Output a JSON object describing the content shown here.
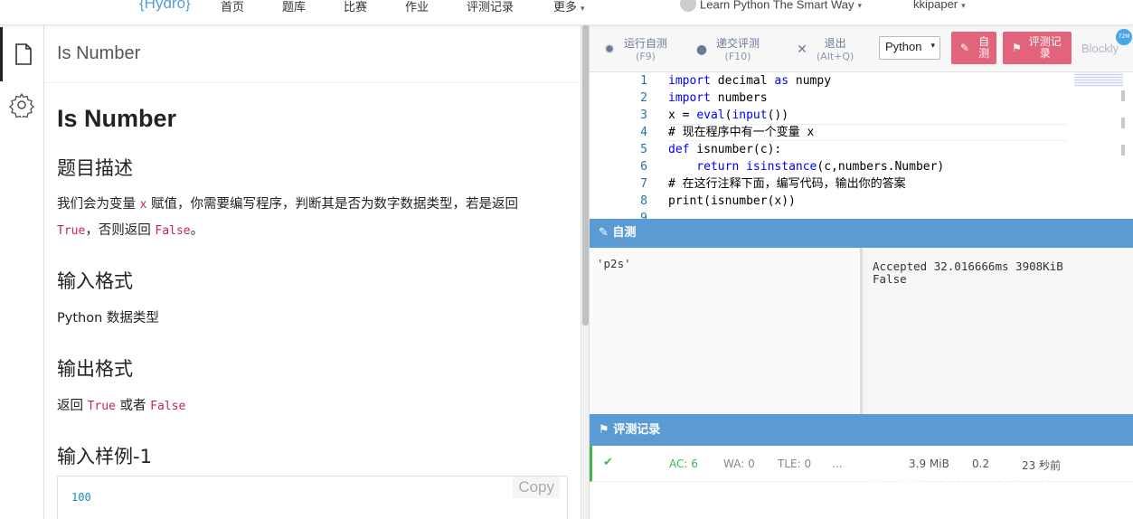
{
  "topnav": {
    "logo": "{Hydro}",
    "items": [
      "首页",
      "题库",
      "比赛",
      "作业",
      "评测记录",
      "更多"
    ],
    "course": "Learn Python The Smart Way",
    "user": "kkipaper"
  },
  "leftbar": {
    "tabs": [
      "problem-content",
      "settings"
    ]
  },
  "problem": {
    "crumb": "Is Number",
    "title": "Is Number",
    "desc_heading": "题目描述",
    "desc_p1": "我们会为变量",
    "desc_var": "x",
    "desc_p2": "赋值，你需要编写程序，判断其是否为数字数据类型，若是返回",
    "desc_true": "True",
    "desc_p3": "，否则返回",
    "desc_false": "False",
    "desc_p4": "。",
    "input_heading": "输入格式",
    "input_text": "Python 数据类型",
    "output_heading": "输出格式",
    "output_p1": "返回",
    "output_true": "True",
    "output_p2": "或者",
    "output_false": "False",
    "sample_heading": "输入样例-1",
    "sample_value": "100",
    "copy_label": "Copy"
  },
  "toolbar": {
    "run_label": "运行自测",
    "run_key": "(F9)",
    "submit_label": "递交评测",
    "submit_key": "(F10)",
    "exit_label": "退出",
    "exit_key": "(Alt+Q)",
    "language": "Python",
    "selftest_label_1": "自",
    "selftest_label_2": "测",
    "records_label_1": "评测记",
    "records_label_2": "录",
    "blockly": "Blockly",
    "badge": "72M"
  },
  "code": {
    "line_numbers": [
      "1",
      "2",
      "3",
      "4",
      "5",
      "6",
      "7",
      "8",
      "9"
    ],
    "l1a": "import",
    "l1b": " decimal ",
    "l1c": "as",
    "l1d": " numpy",
    "l2a": "import",
    "l2b": " numbers",
    "l3a": "x = ",
    "l3b": "eval",
    "l3c": "(",
    "l3d": "input",
    "l3e": "())",
    "l4": "# 现在程序中有一个变量 x",
    "l5a": "def",
    "l5b": " isnumber(c):",
    "l6a": "    return",
    "l6b": " isinstance",
    "l6c": "(c,numbers.Number)",
    "l7": "# 在这行注释下面，编写代码，输出你的答案",
    "l8": "print(isnumber(x))"
  },
  "selftest_panel": {
    "title": "自测",
    "input": "'p2s'",
    "output_line1": "Accepted 32.016666ms 3908KiB",
    "output_line2": "False"
  },
  "records_panel": {
    "title": "评测记录",
    "row": {
      "ac": "AC: 6",
      "wa": "WA: 0",
      "tle": "TLE: 0",
      "more": "...",
      "memory": "3.9 MiB",
      "time": "0.2",
      "when": "23 秒前"
    }
  },
  "watermark": "知乎 @平凡之牛"
}
